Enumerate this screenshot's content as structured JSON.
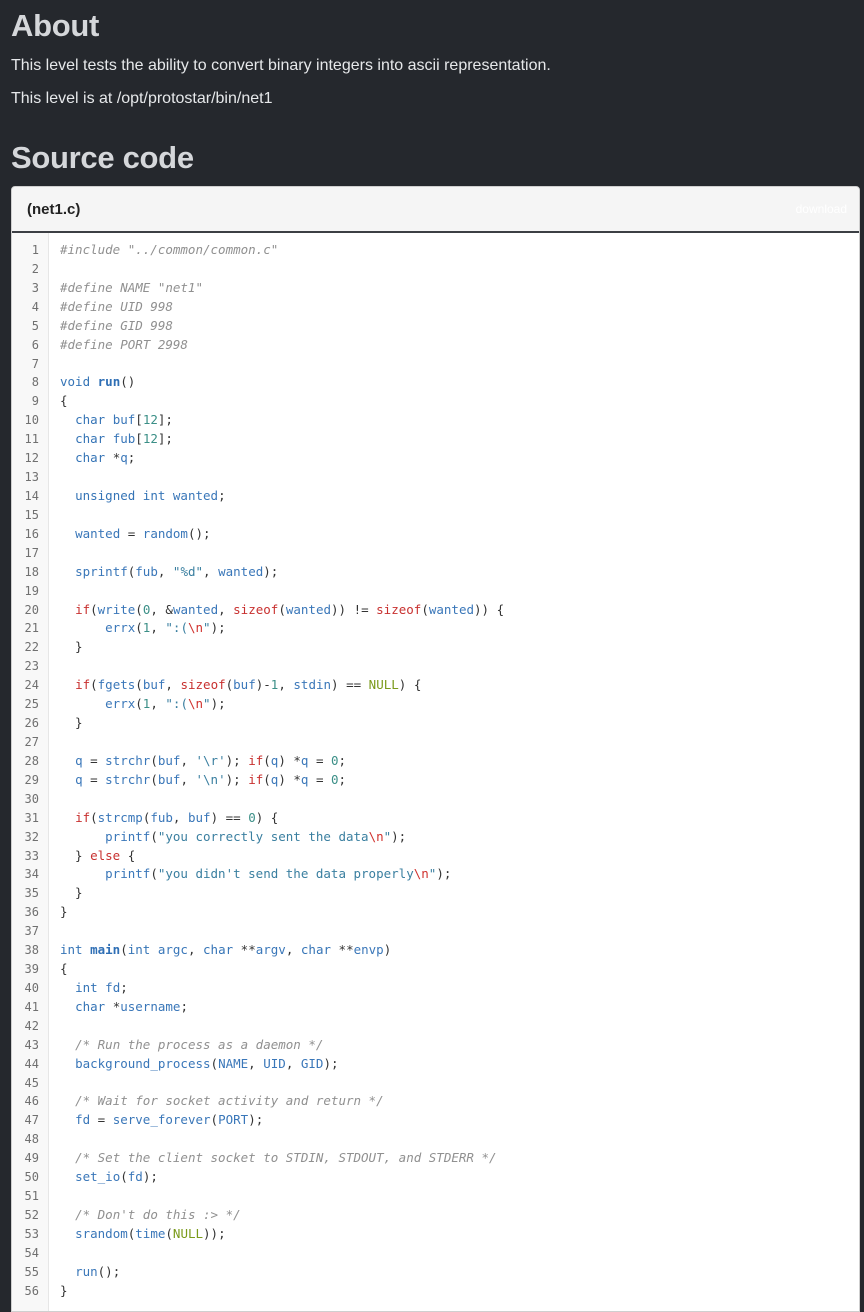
{
  "about": {
    "heading": "About",
    "line1": "This level tests the ability to convert binary integers into ascii representation.",
    "line2": "This level is at /opt/protostar/bin/net1"
  },
  "source": {
    "heading": "Source code",
    "filename": "(net1.c)",
    "download_label": "download",
    "lines": [
      [
        [
          "pp",
          "#include \"../common/common.c\""
        ]
      ],
      [],
      [
        [
          "pp",
          "#define NAME \"net1\""
        ]
      ],
      [
        [
          "pp",
          "#define UID 998"
        ]
      ],
      [
        [
          "pp",
          "#define GID 998"
        ]
      ],
      [
        [
          "pp",
          "#define PORT 2998"
        ]
      ],
      [],
      [
        [
          "ty",
          "void "
        ],
        [
          "fn",
          "run"
        ],
        [
          "p",
          "()"
        ]
      ],
      [
        [
          "p",
          "{"
        ]
      ],
      [
        [
          "p",
          "  "
        ],
        [
          "ty",
          "char "
        ],
        [
          "id",
          "buf"
        ],
        [
          "p",
          "["
        ],
        [
          "num",
          "12"
        ],
        [
          "p",
          "];"
        ]
      ],
      [
        [
          "p",
          "  "
        ],
        [
          "ty",
          "char "
        ],
        [
          "id",
          "fub"
        ],
        [
          "p",
          "["
        ],
        [
          "num",
          "12"
        ],
        [
          "p",
          "];"
        ]
      ],
      [
        [
          "p",
          "  "
        ],
        [
          "ty",
          "char "
        ],
        [
          "p",
          "*"
        ],
        [
          "id",
          "q"
        ],
        [
          "p",
          ";"
        ]
      ],
      [],
      [
        [
          "p",
          "  "
        ],
        [
          "ty",
          "unsigned int "
        ],
        [
          "id",
          "wanted"
        ],
        [
          "p",
          ";"
        ]
      ],
      [],
      [
        [
          "p",
          "  "
        ],
        [
          "id",
          "wanted"
        ],
        [
          "p",
          " = "
        ],
        [
          "id",
          "random"
        ],
        [
          "p",
          "();"
        ]
      ],
      [],
      [
        [
          "p",
          "  "
        ],
        [
          "id",
          "sprintf"
        ],
        [
          "p",
          "("
        ],
        [
          "id",
          "fub"
        ],
        [
          "p",
          ", "
        ],
        [
          "str",
          "\"%d\""
        ],
        [
          "p",
          ", "
        ],
        [
          "id",
          "wanted"
        ],
        [
          "p",
          ");"
        ]
      ],
      [],
      [
        [
          "p",
          "  "
        ],
        [
          "ctl",
          "if"
        ],
        [
          "p",
          "("
        ],
        [
          "id",
          "write"
        ],
        [
          "p",
          "("
        ],
        [
          "num",
          "0"
        ],
        [
          "p",
          ", &"
        ],
        [
          "id",
          "wanted"
        ],
        [
          "p",
          ", "
        ],
        [
          "ctl",
          "sizeof"
        ],
        [
          "p",
          "("
        ],
        [
          "id",
          "wanted"
        ],
        [
          "p",
          ")) != "
        ],
        [
          "ctl",
          "sizeof"
        ],
        [
          "p",
          "("
        ],
        [
          "id",
          "wanted"
        ],
        [
          "p",
          ")) {"
        ]
      ],
      [
        [
          "p",
          "      "
        ],
        [
          "id",
          "errx"
        ],
        [
          "p",
          "("
        ],
        [
          "num",
          "1"
        ],
        [
          "p",
          ", "
        ],
        [
          "str",
          "\":("
        ],
        [
          "esc",
          "\\n"
        ],
        [
          "str",
          "\""
        ],
        [
          "p",
          ");"
        ]
      ],
      [
        [
          "p",
          "  }"
        ]
      ],
      [],
      [
        [
          "p",
          "  "
        ],
        [
          "ctl",
          "if"
        ],
        [
          "p",
          "("
        ],
        [
          "id",
          "fgets"
        ],
        [
          "p",
          "("
        ],
        [
          "id",
          "buf"
        ],
        [
          "p",
          ", "
        ],
        [
          "ctl",
          "sizeof"
        ],
        [
          "p",
          "("
        ],
        [
          "id",
          "buf"
        ],
        [
          "p",
          ")-"
        ],
        [
          "num",
          "1"
        ],
        [
          "p",
          ", "
        ],
        [
          "id",
          "stdin"
        ],
        [
          "p",
          ") == "
        ],
        [
          "nul",
          "NULL"
        ],
        [
          "p",
          ") {"
        ]
      ],
      [
        [
          "p",
          "      "
        ],
        [
          "id",
          "errx"
        ],
        [
          "p",
          "("
        ],
        [
          "num",
          "1"
        ],
        [
          "p",
          ", "
        ],
        [
          "str",
          "\":("
        ],
        [
          "esc",
          "\\n"
        ],
        [
          "str",
          "\""
        ],
        [
          "p",
          ");"
        ]
      ],
      [
        [
          "p",
          "  }"
        ]
      ],
      [],
      [
        [
          "p",
          "  "
        ],
        [
          "id",
          "q"
        ],
        [
          "p",
          " = "
        ],
        [
          "id",
          "strchr"
        ],
        [
          "p",
          "("
        ],
        [
          "id",
          "buf"
        ],
        [
          "p",
          ", "
        ],
        [
          "str",
          "'\\r'"
        ],
        [
          "p",
          "); "
        ],
        [
          "ctl",
          "if"
        ],
        [
          "p",
          "("
        ],
        [
          "id",
          "q"
        ],
        [
          "p",
          ") *"
        ],
        [
          "id",
          "q"
        ],
        [
          "p",
          " = "
        ],
        [
          "num",
          "0"
        ],
        [
          "p",
          ";"
        ]
      ],
      [
        [
          "p",
          "  "
        ],
        [
          "id",
          "q"
        ],
        [
          "p",
          " = "
        ],
        [
          "id",
          "strchr"
        ],
        [
          "p",
          "("
        ],
        [
          "id",
          "buf"
        ],
        [
          "p",
          ", "
        ],
        [
          "str",
          "'\\n'"
        ],
        [
          "p",
          "); "
        ],
        [
          "ctl",
          "if"
        ],
        [
          "p",
          "("
        ],
        [
          "id",
          "q"
        ],
        [
          "p",
          ") *"
        ],
        [
          "id",
          "q"
        ],
        [
          "p",
          " = "
        ],
        [
          "num",
          "0"
        ],
        [
          "p",
          ";"
        ]
      ],
      [],
      [
        [
          "p",
          "  "
        ],
        [
          "ctl",
          "if"
        ],
        [
          "p",
          "("
        ],
        [
          "id",
          "strcmp"
        ],
        [
          "p",
          "("
        ],
        [
          "id",
          "fub"
        ],
        [
          "p",
          ", "
        ],
        [
          "id",
          "buf"
        ],
        [
          "p",
          ") == "
        ],
        [
          "num",
          "0"
        ],
        [
          "p",
          ") {"
        ]
      ],
      [
        [
          "p",
          "      "
        ],
        [
          "id",
          "printf"
        ],
        [
          "p",
          "("
        ],
        [
          "str",
          "\"you correctly sent the data"
        ],
        [
          "esc",
          "\\n"
        ],
        [
          "str",
          "\""
        ],
        [
          "p",
          ");"
        ]
      ],
      [
        [
          "p",
          "  } "
        ],
        [
          "ctl",
          "else"
        ],
        [
          "p",
          " {"
        ]
      ],
      [
        [
          "p",
          "      "
        ],
        [
          "id",
          "printf"
        ],
        [
          "p",
          "("
        ],
        [
          "str",
          "\"you didn't send the data properly"
        ],
        [
          "esc",
          "\\n"
        ],
        [
          "str",
          "\""
        ],
        [
          "p",
          ");"
        ]
      ],
      [
        [
          "p",
          "  }"
        ]
      ],
      [
        [
          "p",
          "}"
        ]
      ],
      [],
      [
        [
          "ty",
          "int "
        ],
        [
          "fn",
          "main"
        ],
        [
          "p",
          "("
        ],
        [
          "ty",
          "int "
        ],
        [
          "id",
          "argc"
        ],
        [
          "p",
          ", "
        ],
        [
          "ty",
          "char "
        ],
        [
          "p",
          "**"
        ],
        [
          "id",
          "argv"
        ],
        [
          "p",
          ", "
        ],
        [
          "ty",
          "char "
        ],
        [
          "p",
          "**"
        ],
        [
          "id",
          "envp"
        ],
        [
          "p",
          ")"
        ]
      ],
      [
        [
          "p",
          "{"
        ]
      ],
      [
        [
          "p",
          "  "
        ],
        [
          "ty",
          "int "
        ],
        [
          "id",
          "fd"
        ],
        [
          "p",
          ";"
        ]
      ],
      [
        [
          "p",
          "  "
        ],
        [
          "ty",
          "char "
        ],
        [
          "p",
          "*"
        ],
        [
          "id",
          "username"
        ],
        [
          "p",
          ";"
        ]
      ],
      [],
      [
        [
          "p",
          "  "
        ],
        [
          "cm",
          "/* Run the process as a daemon */"
        ]
      ],
      [
        [
          "p",
          "  "
        ],
        [
          "id",
          "background_process"
        ],
        [
          "p",
          "("
        ],
        [
          "id",
          "NAME"
        ],
        [
          "p",
          ", "
        ],
        [
          "id",
          "UID"
        ],
        [
          "p",
          ", "
        ],
        [
          "id",
          "GID"
        ],
        [
          "p",
          ");"
        ]
      ],
      [],
      [
        [
          "p",
          "  "
        ],
        [
          "cm",
          "/* Wait for socket activity and return */"
        ]
      ],
      [
        [
          "p",
          "  "
        ],
        [
          "id",
          "fd"
        ],
        [
          "p",
          " = "
        ],
        [
          "id",
          "serve_forever"
        ],
        [
          "p",
          "("
        ],
        [
          "id",
          "PORT"
        ],
        [
          "p",
          ");"
        ]
      ],
      [],
      [
        [
          "p",
          "  "
        ],
        [
          "cm",
          "/* Set the client socket to STDIN, STDOUT, and STDERR */"
        ]
      ],
      [
        [
          "p",
          "  "
        ],
        [
          "id",
          "set_io"
        ],
        [
          "p",
          "("
        ],
        [
          "id",
          "fd"
        ],
        [
          "p",
          ");"
        ]
      ],
      [],
      [
        [
          "p",
          "  "
        ],
        [
          "cm",
          "/* Don't do this :> */"
        ]
      ],
      [
        [
          "p",
          "  "
        ],
        [
          "id",
          "srandom"
        ],
        [
          "p",
          "("
        ],
        [
          "id",
          "time"
        ],
        [
          "p",
          "("
        ],
        [
          "nul",
          "NULL"
        ],
        [
          "p",
          "));"
        ]
      ],
      [],
      [
        [
          "p",
          "  "
        ],
        [
          "id",
          "run"
        ],
        [
          "p",
          "();"
        ]
      ],
      [
        [
          "p",
          "}"
        ]
      ]
    ]
  }
}
